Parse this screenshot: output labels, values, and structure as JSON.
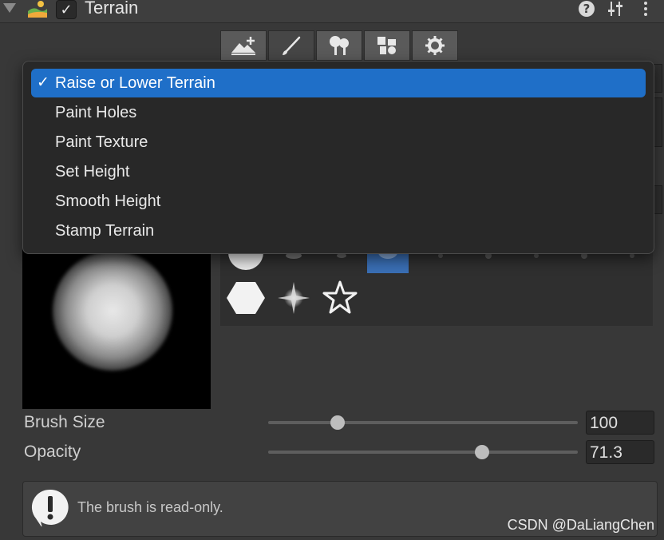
{
  "header": {
    "title": "Terrain",
    "enabled_checkmark": "✓",
    "help_label": "?",
    "settings_label": "⧉",
    "more_label": "⋮"
  },
  "toolbar": {
    "tools": [
      {
        "name": "raise-terrain-tool",
        "icon": "mountain-plus-icon"
      },
      {
        "name": "paint-brush-tool",
        "icon": "paintbrush-icon"
      },
      {
        "name": "paint-trees-tool",
        "icon": "trees-icon"
      },
      {
        "name": "paint-details-tool",
        "icon": "details-icon"
      },
      {
        "name": "settings-tool",
        "icon": "gear-icon"
      }
    ],
    "active_index": 1
  },
  "dropdown": {
    "check": "✓",
    "items": [
      "Raise or Lower Terrain",
      "Paint Holes",
      "Paint Texture",
      "Set Height",
      "Smooth Height",
      "Stamp Terrain"
    ],
    "selected_index": 0
  },
  "brush_size": {
    "label": "Brush Size",
    "value": "100",
    "fraction": 0.21
  },
  "opacity": {
    "label": "Opacity",
    "value": "71.3",
    "fraction": 0.7
  },
  "help": {
    "text": "The brush is read-only."
  },
  "watermark": "CSDN @DaLiangChen",
  "colors": {
    "accent": "#1f6fc8",
    "panel": "#383838",
    "menu": "#282828"
  }
}
